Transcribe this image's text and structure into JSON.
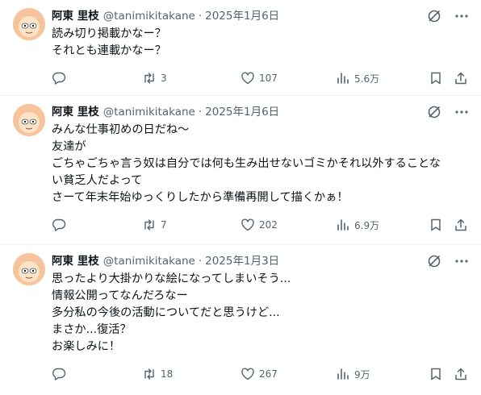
{
  "tweets": [
    {
      "author_name": "阿東 里枝",
      "handle": "@tanimikitakane",
      "separator": "·",
      "date": "2025年1月6日",
      "text": "読み切り掲載かなー？\nそれとも連載かなー？",
      "retweets": "3",
      "likes": "107",
      "views": "5.6万"
    },
    {
      "author_name": "阿東 里枝",
      "handle": "@tanimikitakane",
      "separator": "·",
      "date": "2025年1月6日",
      "text": "みんな仕事初めの日だね〜\n友達が\nごちゃごちゃ言う奴は自分では何も生み出せないゴミかそれ以外することな\nい貧乏人だよって\nさーて年末年始ゆっくりしたから準備再開して描くかぁ！",
      "retweets": "7",
      "likes": "202",
      "views": "6.9万"
    },
    {
      "author_name": "阿東 里枝",
      "handle": "@tanimikitakane",
      "separator": "·",
      "date": "2025年1月3日",
      "text": "思ったより大掛かりな絵になってしまいそう...\n情報公開ってなんだろなー\n多分私の今後の活動についてだと思うけど...\nまさか...復活？\nお楽しみに！",
      "retweets": "18",
      "likes": "267",
      "views": "9万"
    }
  ],
  "icons": {
    "avatar": "avatar-icon",
    "grok": "grok-icon",
    "more": "more-icon",
    "reply": "reply-icon",
    "retweet": "retweet-icon",
    "like": "like-icon",
    "views": "views-icon",
    "bookmark": "bookmark-icon",
    "share": "share-icon"
  },
  "colors": {
    "text": "#0f1419",
    "secondary": "#536471",
    "divider": "#eff3f4",
    "avatar_skin": "#f6c39a"
  }
}
